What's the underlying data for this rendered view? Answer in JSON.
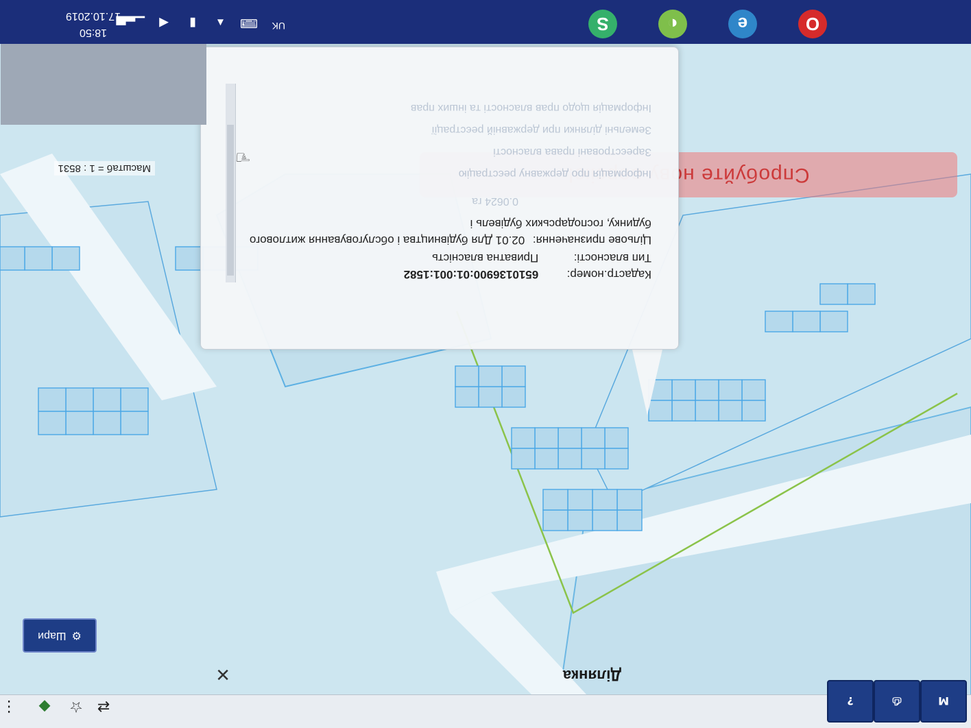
{
  "browser_toolbar": {
    "help_button_label": "?",
    "print_button_label": "⎙",
    "left_button_label": "M"
  },
  "layers_button": {
    "label": "Шари",
    "icon": "gear-icon"
  },
  "promo_banner": {
    "text": "Спробуйте нову версію!"
  },
  "popup": {
    "title": "Ділянка",
    "close_label": "✕",
    "rows": [
      {
        "label": "Кадастр.номер:",
        "value": "6510136900:01:001:1582"
      },
      {
        "label": "Тип власності:",
        "value": "Приватна власність"
      },
      {
        "label": "Цільове призначення:",
        "value": "02.01 Для будівництва і обслуговування житлового будинку, господарських будівель і"
      }
    ],
    "area": "0.0624 га",
    "faded_lines": [
      "Інформація про державну реєстрацію",
      "Зареєстровані права власності",
      "Земельні ділянки при державній реєстрації",
      "Інформація щодо прав власності та інших прав"
    ]
  },
  "scale": {
    "label": "Масштаб = 1 : 8531"
  },
  "taskbar": {
    "time": "18:50",
    "date": "17.10.2019",
    "language": "UK"
  },
  "colors": {
    "map_background": "#cde6f0",
    "parcel_fill": "#b5d9ec",
    "parcel_stroke": "#4aa7e6",
    "boundary_line": "#8bc34a",
    "taskbar": "#1b2e7a",
    "accent_button": "#1e3d86"
  }
}
